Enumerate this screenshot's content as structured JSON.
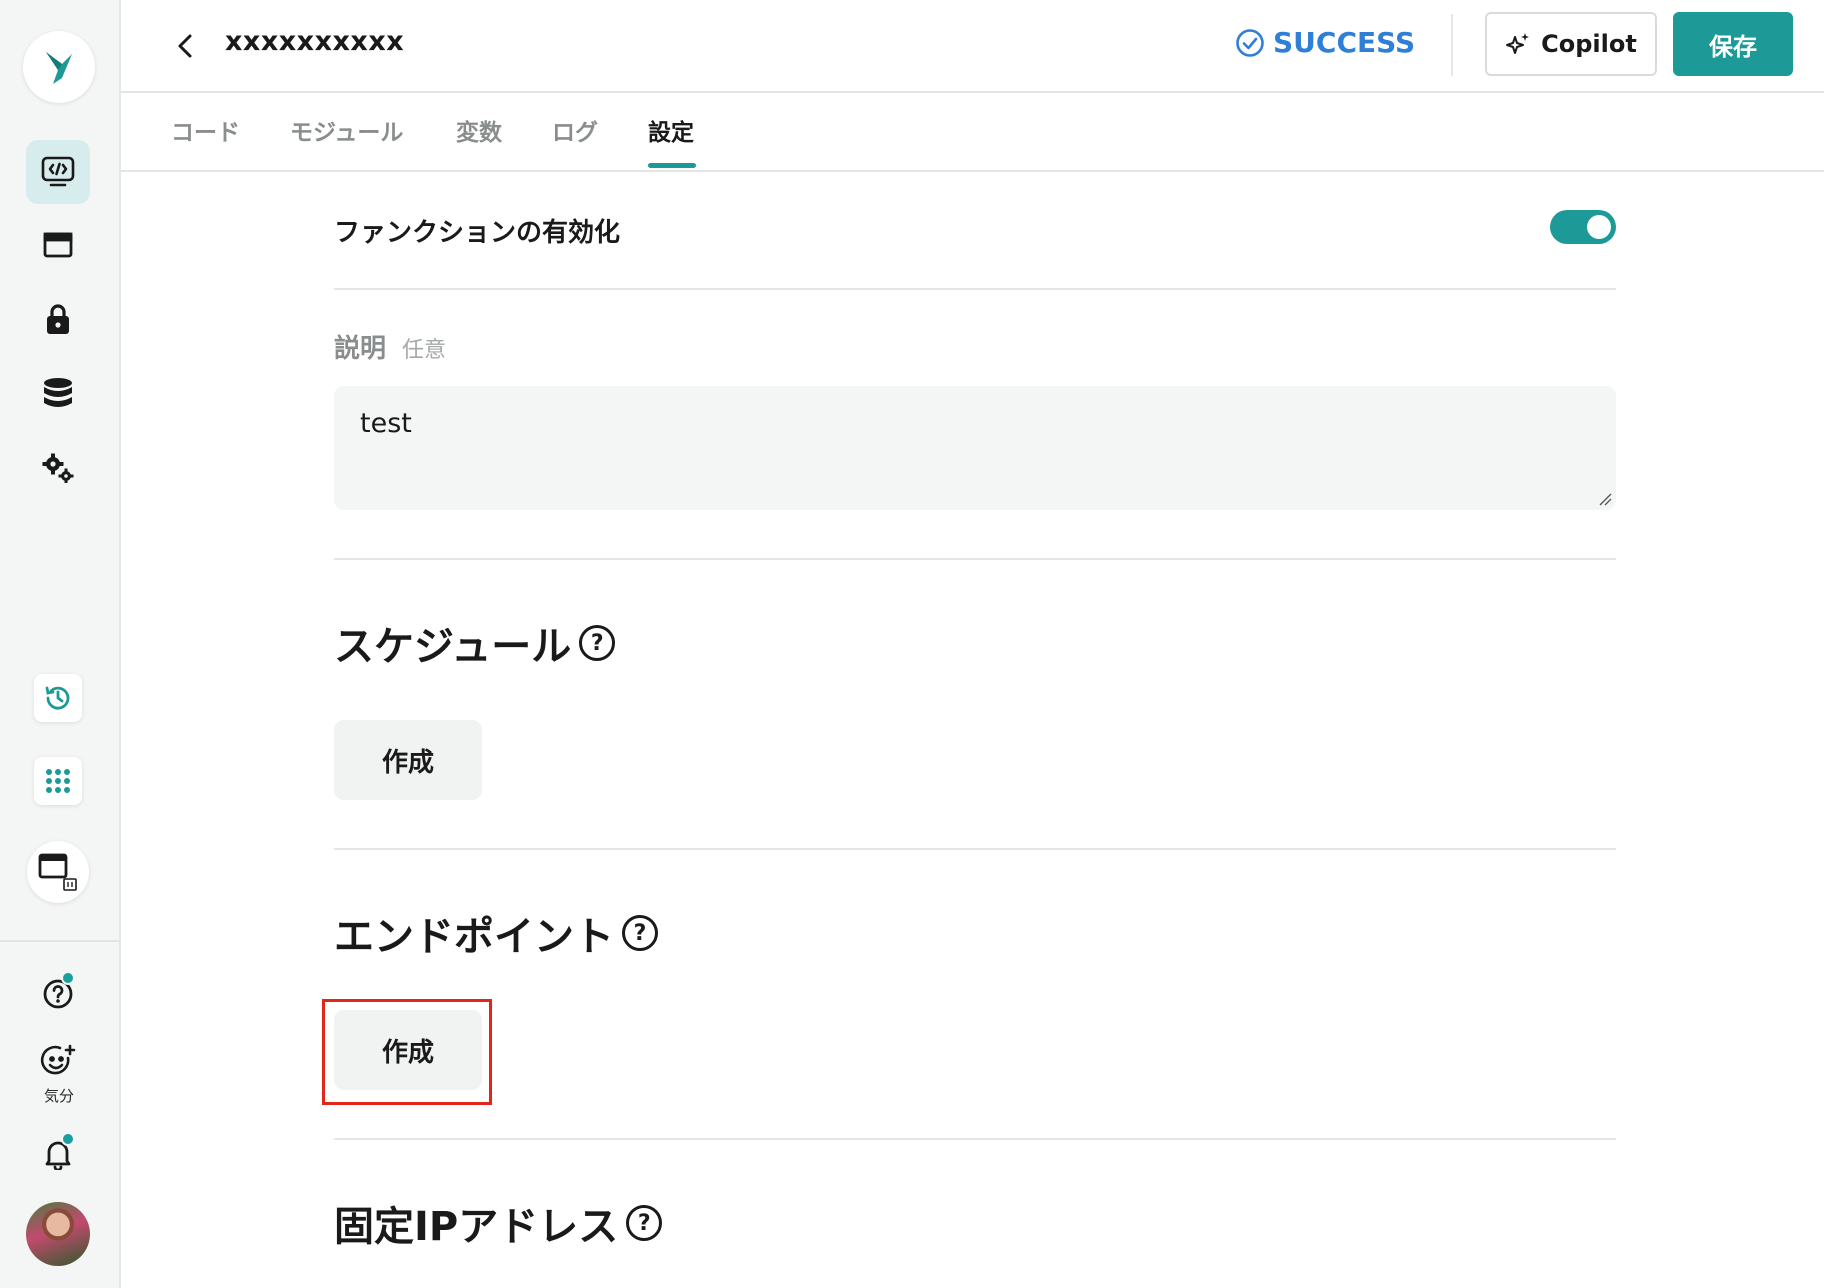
{
  "header": {
    "function_name": "xxxxxxxxxx",
    "status": "SUCCESS",
    "copilot_label": "Copilot",
    "save_label": "保存"
  },
  "tabs": [
    {
      "label": "コード",
      "active": false
    },
    {
      "label": "モジュール",
      "active": false
    },
    {
      "label": "変数",
      "active": false
    },
    {
      "label": "ログ",
      "active": false
    },
    {
      "label": "設定",
      "active": true
    }
  ],
  "settings": {
    "enable_label": "ファンクションの有効化",
    "enable_on": true,
    "description_label": "説明",
    "description_optional": "任意",
    "description_value": "test"
  },
  "sections": {
    "schedule": {
      "title": "スケジュール",
      "button": "作成"
    },
    "endpoint": {
      "title": "エンドポイント",
      "button": "作成"
    },
    "static_ip": {
      "title": "固定IPアドレス"
    }
  },
  "sidebar": {
    "mood_label": "気分",
    "icons": [
      "logo-icon",
      "code-editor-icon",
      "window-icon",
      "lock-icon",
      "database-icon",
      "gears-icon",
      "history-icon",
      "apps-grid-icon",
      "app-window-icon",
      "help-icon",
      "mood-icon",
      "bell-icon",
      "avatar"
    ]
  },
  "colors": {
    "accent": "#1d9a98",
    "status_blue": "#2f7fd6",
    "highlight_red": "#e1261c"
  }
}
